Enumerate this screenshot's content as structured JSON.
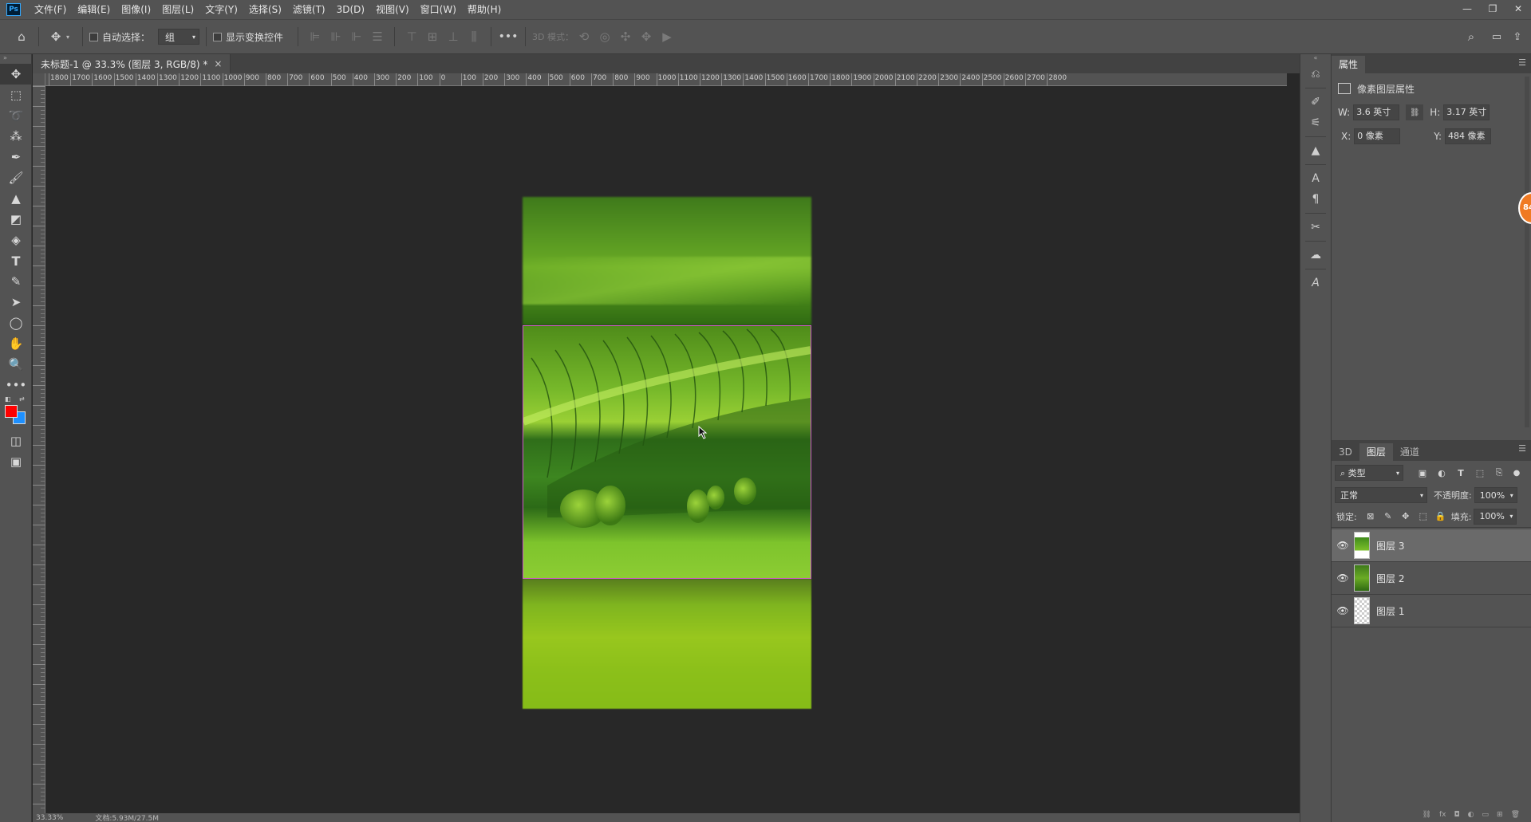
{
  "menubar": {
    "logo": "Ps",
    "items": [
      "文件(F)",
      "编辑(E)",
      "图像(I)",
      "图层(L)",
      "文字(Y)",
      "选择(S)",
      "滤镜(T)",
      "3D(D)",
      "视图(V)",
      "窗口(W)",
      "帮助(H)"
    ],
    "window_controls": [
      "—",
      "❐",
      "✕"
    ]
  },
  "options_bar": {
    "auto_select_label": "自动选择：",
    "auto_select_value": "组",
    "show_transform_label": "显示变换控件",
    "mode_3d_label": "3D 模式："
  },
  "document": {
    "tab_title": "未标题-1 @ 33.3% (图层 3, RGB/8) *",
    "close": "×"
  },
  "ruler": {
    "top_labels": [
      "1800",
      "1700",
      "1600",
      "1500",
      "1400",
      "1300",
      "1200",
      "1100",
      "1000",
      "900",
      "800",
      "700",
      "600",
      "500",
      "400",
      "300",
      "200",
      "100",
      "0",
      "100",
      "200",
      "300",
      "400",
      "500",
      "600",
      "700",
      "800",
      "900",
      "1000",
      "1100",
      "1200",
      "1300",
      "1400",
      "1500",
      "1600",
      "1700",
      "1800",
      "1900",
      "2000",
      "2100",
      "2200",
      "2300",
      "2400",
      "2500",
      "2600",
      "2700",
      "2800"
    ]
  },
  "status": {
    "zoom": "33.33%",
    "doc": "文档:5.93M/27.5M"
  },
  "properties": {
    "tab_label": "属性",
    "type_label": "像素图层属性",
    "w_label": "W:",
    "w_value": "3.6 英寸",
    "h_label": "H:",
    "h_value": "3.17 英寸",
    "x_label": "X:",
    "x_value": "0 像素",
    "y_label": "Y:",
    "y_value": "484 像素"
  },
  "layers_panel": {
    "tabs": [
      "3D",
      "图层",
      "通道"
    ],
    "filter_kind": "类型",
    "blend_mode": "正常",
    "opacity_label": "不透明度:",
    "opacity_value": "100%",
    "lock_label": "锁定:",
    "fill_label": "填充:",
    "fill_value": "100%",
    "layers": [
      {
        "name": "图层 3",
        "selected": true
      },
      {
        "name": "图层 2",
        "selected": false
      },
      {
        "name": "图层 1",
        "selected": false
      }
    ]
  },
  "badge": "84",
  "colors": {
    "foreground": "#ff0000",
    "background": "#1e90ff",
    "selection_border": "#d05cc8"
  }
}
